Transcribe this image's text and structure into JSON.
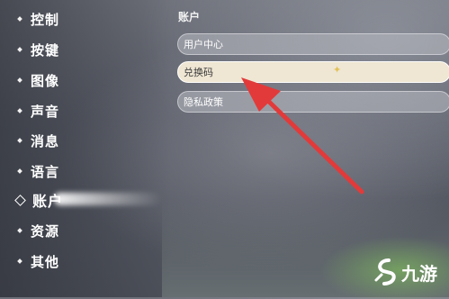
{
  "sidebar": {
    "items": [
      {
        "label": "控制"
      },
      {
        "label": "按键"
      },
      {
        "label": "图像"
      },
      {
        "label": "声音"
      },
      {
        "label": "消息"
      },
      {
        "label": "语言"
      },
      {
        "label": "账户",
        "active": true
      },
      {
        "label": "资源"
      },
      {
        "label": "其他"
      }
    ]
  },
  "account": {
    "title": "账户",
    "options": [
      {
        "label": "用户中心"
      },
      {
        "label": "兑换码",
        "selected": true
      },
      {
        "label": "隐私政策"
      }
    ]
  },
  "watermark": {
    "text": "九游"
  },
  "colors": {
    "arrow": "#e23a3a",
    "selected_bg": "#efe6d3"
  }
}
